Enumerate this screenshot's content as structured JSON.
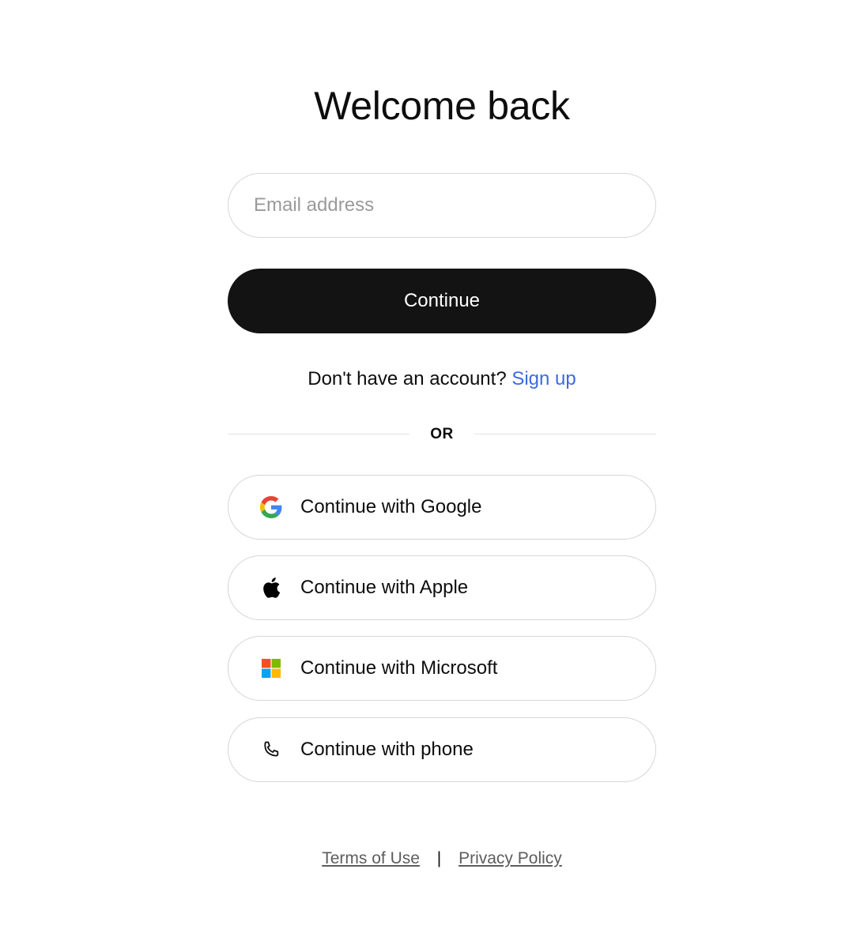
{
  "header": {
    "title": "Welcome back"
  },
  "form": {
    "email_placeholder": "Email address",
    "email_value": "",
    "continue_label": "Continue"
  },
  "signup": {
    "prompt": "Don't have an account?",
    "link_label": "Sign up",
    "link_color": "#3e6ae1"
  },
  "divider": {
    "label": "OR"
  },
  "social": [
    {
      "label": "Continue with Google",
      "icon": "google-icon"
    },
    {
      "label": "Continue with Apple",
      "icon": "apple-icon"
    },
    {
      "label": "Continue with Microsoft",
      "icon": "microsoft-icon"
    },
    {
      "label": "Continue with phone",
      "icon": "phone-icon"
    }
  ],
  "footer": {
    "terms_label": "Terms of Use",
    "separator": "|",
    "privacy_label": "Privacy Policy"
  },
  "colors": {
    "primary_button": "#131313",
    "link": "#3e6ae1",
    "border": "#d6d6d6"
  }
}
